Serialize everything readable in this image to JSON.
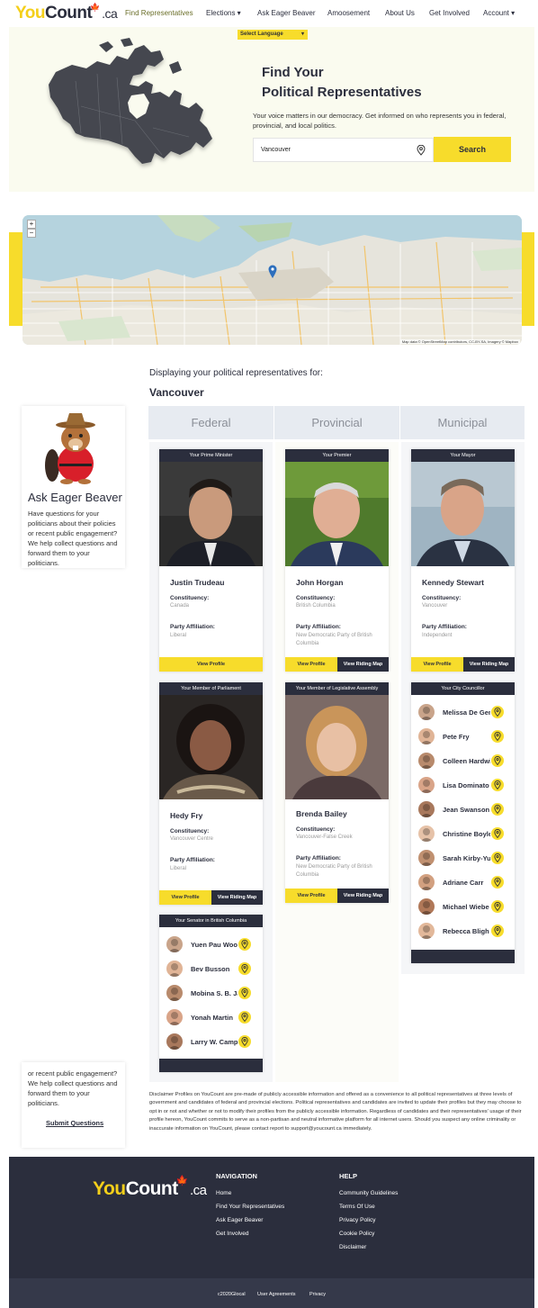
{
  "nav": {
    "logo": {
      "you": "You",
      "count": "Count",
      "ca": ".ca"
    },
    "links": [
      "Find Representatives",
      "Elections ▾",
      "Ask Eager Beaver",
      "Amoosement",
      "About Us",
      "Get Involved",
      "Account ▾"
    ]
  },
  "hero": {
    "language": "Select Language",
    "title_1": "Find Your",
    "title_2": "Political Representatives",
    "subtitle": "Your voice matters in our democracy. Get informed on who represents you in federal, provincial, and local politics.",
    "search_value": "Vancouver",
    "search_button": "Search"
  },
  "map": {
    "zoom_in": "+",
    "zoom_out": "−",
    "attribution": "Map data © OpenStreetMap contributors, CC-BY-SA, Imagery © Mapbox"
  },
  "results": {
    "label": "Displaying your political representatives for:",
    "city": "Vancouver",
    "tabs": [
      "Federal",
      "Provincial",
      "Municipal"
    ]
  },
  "beaver": {
    "title": "Ask Eager Beaver",
    "text_top": "Have questions for your politicians about their policies or recent public engagement? We help collect questions and forward them to your politicians.",
    "text_bottom": "or recent public engagement? We help collect questions and forward them to your politicians.",
    "submit": "Submit Questions"
  },
  "labels": {
    "constituency": "Constituency:",
    "party": "Party Affiliation:",
    "view_profile": "View Profile",
    "view_map": "View Riding Map"
  },
  "cards": {
    "pm": {
      "head": "Your Prime Minister",
      "name": "Justin Trudeau",
      "constituency": "Canada",
      "party": "Liberal"
    },
    "premier": {
      "head": "Your Premier",
      "name": "John Horgan",
      "constituency": "British Columbia",
      "party": "New Democratic Party of British Columbia"
    },
    "mayor": {
      "head": "Your Mayor",
      "name": "Kennedy Stewart",
      "constituency": "Vancouver",
      "party": "Independent"
    },
    "mp": {
      "head": "Your Member of Parliament",
      "name": "Hedy Fry",
      "constituency": "Vancouver Centre",
      "party": "Liberal"
    },
    "mla": {
      "head": "Your Member of Legislative Assembly",
      "name": "Brenda Bailey",
      "constituency": "Vancouver-False Creek",
      "party": "New Democratic Party of British Columbia"
    }
  },
  "councillors": {
    "head": "Your City Councillor",
    "names": [
      "Melissa De Genova",
      "Pete Fry",
      "Colleen Hardwick",
      "Lisa Dominato",
      "Jean Swanson",
      "Christine Boyle",
      "Sarah Kirby-Yung",
      "Adriane Carr",
      "Michael Wiebe",
      "Rebecca Bligh"
    ]
  },
  "senators": {
    "head": "Your Senator in British Columbia",
    "names": [
      "Yuen Pau Woo",
      "Bev Busson",
      "Mobina S. B. Jaffer",
      "Yonah Martin",
      "Larry W. Campbell"
    ]
  },
  "disclaimer": "Disclaimer Profiles on YouCount are pre-made of publicly accessible information and offered as a convenience to all political representatives at three levels of government and candidates of federal and provincial elections. Political representatives and candidates are invited to update their profiles but they may choose to opt in or not and whether or not to modify their profiles from the publicly accessible information. Regardless of candidates and their representatives' usage of their profile hereon, YouCount commits to serve as a non-partisan and neutral informative platform for all internet users. Should you suspect any online criminality or inaccurate information on YouCount, please contact report to support@youcount.ca immediately.",
  "footer": {
    "nav_head": "NAVIGATION",
    "nav_links": [
      "Home",
      "Find Your Representatives",
      "Ask Eager Beaver",
      "Get Involved"
    ],
    "help_head": "HELP",
    "help_links": [
      "Community Guidelines",
      "Terms Of Use",
      "Privacy Policy",
      "Cookie Policy",
      "Disclaimer"
    ],
    "bottom": [
      "c2020Glocal",
      "User Agreements",
      "Privacy"
    ]
  },
  "colors": {
    "accent": "#f7dc2b",
    "dark": "#2b2e3d",
    "brand_red": "#d8252b"
  }
}
